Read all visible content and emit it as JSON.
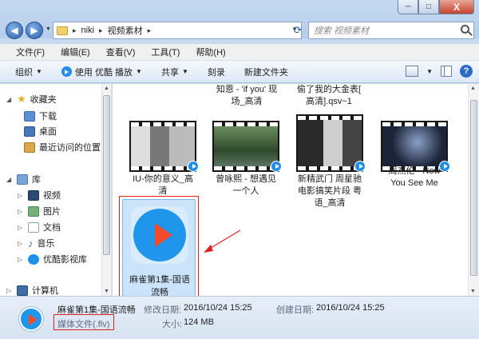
{
  "window": {
    "buttons": [
      "─",
      "□",
      "X"
    ]
  },
  "address": {
    "segments": [
      "niki",
      "视频素材"
    ],
    "search_placeholder": "搜索 视频素材"
  },
  "menu": [
    "文件(F)",
    "编辑(E)",
    "查看(V)",
    "工具(T)",
    "帮助(H)"
  ],
  "toolbar": {
    "organize": "组织",
    "play_with": "使用 优酷 播放",
    "share": "共享",
    "burn": "刻录",
    "new_folder": "新建文件夹"
  },
  "nav": {
    "favorites": "收藏夹",
    "downloads": "下载",
    "desktop": "桌面",
    "recent": "最近访问的位置",
    "libraries": "库",
    "videos": "视频",
    "pictures": "图片",
    "documents": "文档",
    "music": "音乐",
    "youku_lib": "优酷影视库",
    "computer": "计算机"
  },
  "files": {
    "top1_l1": "知恩 - 'if you' 现",
    "top1_l2": "场_高清",
    "top2_l1": "偷了我的大金表[",
    "top2_l2": "高清].qsv~1",
    "f1_l1": "IU-你的意义_高",
    "f1_l2": "清",
    "f2_l1": "曾咏熙 - 想遇见",
    "f2_l2": "一个人",
    "f3_l1": "新精武门 周星驰",
    "f3_l2": "电影搞笑片段 粤",
    "f3_l3": "语_高清",
    "f4_l1": "周杰伦 - Now",
    "f4_l2": "You See Me",
    "sel_l1": "麻雀第1集-国语",
    "sel_l2": "流畅"
  },
  "status": {
    "file_name": "麻雀第1集-国语流畅",
    "modified_key": "修改日期:",
    "modified_val": "2016/10/24 15:25",
    "created_key": "创建日期:",
    "created_val": "2016/10/24 15:25",
    "type": "媒体文件(.flv)",
    "size_key": "大小:",
    "size_val": "124 MB"
  },
  "colors": {
    "selection": "#cce4fb",
    "annotation_red": "#e02020",
    "youku_blue": "#1f95eb",
    "youku_red": "#f24b2b"
  }
}
